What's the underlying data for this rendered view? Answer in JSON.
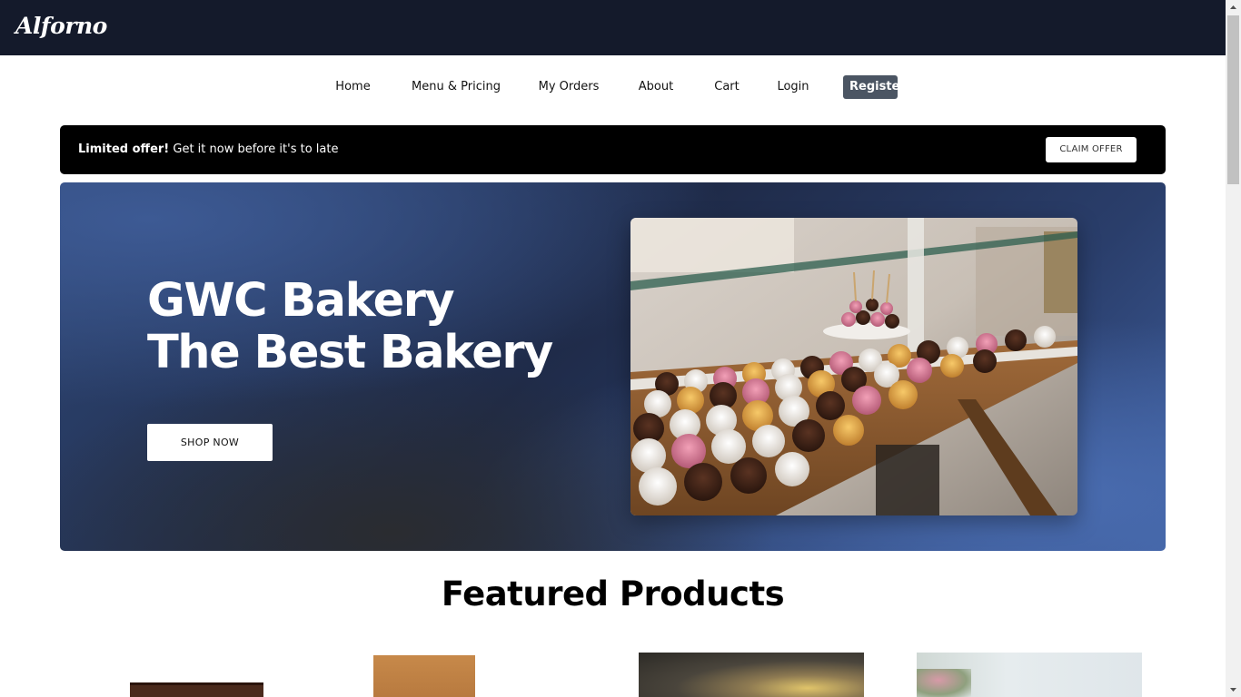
{
  "brand": {
    "logo_text": "Alforno"
  },
  "nav": {
    "items": [
      {
        "label": "Home"
      },
      {
        "label": "Menu & Pricing"
      },
      {
        "label": "My Orders"
      },
      {
        "label": "About"
      },
      {
        "label": "Cart"
      },
      {
        "label": "Login"
      },
      {
        "label": "Register"
      }
    ]
  },
  "offer": {
    "bold_text": "Limited offer!",
    "text": " Get it now before it's to late",
    "button_label": "CLAIM OFFER"
  },
  "hero": {
    "title_line1": "GWC Bakery",
    "title_line2": "The Best Bakery",
    "button_label": "SHOP NOW"
  },
  "featured": {
    "title": "Featured Products"
  },
  "colors": {
    "topbar": "#141a2b",
    "hero_accent": "#2e4674",
    "register_button": "#4b5563"
  }
}
